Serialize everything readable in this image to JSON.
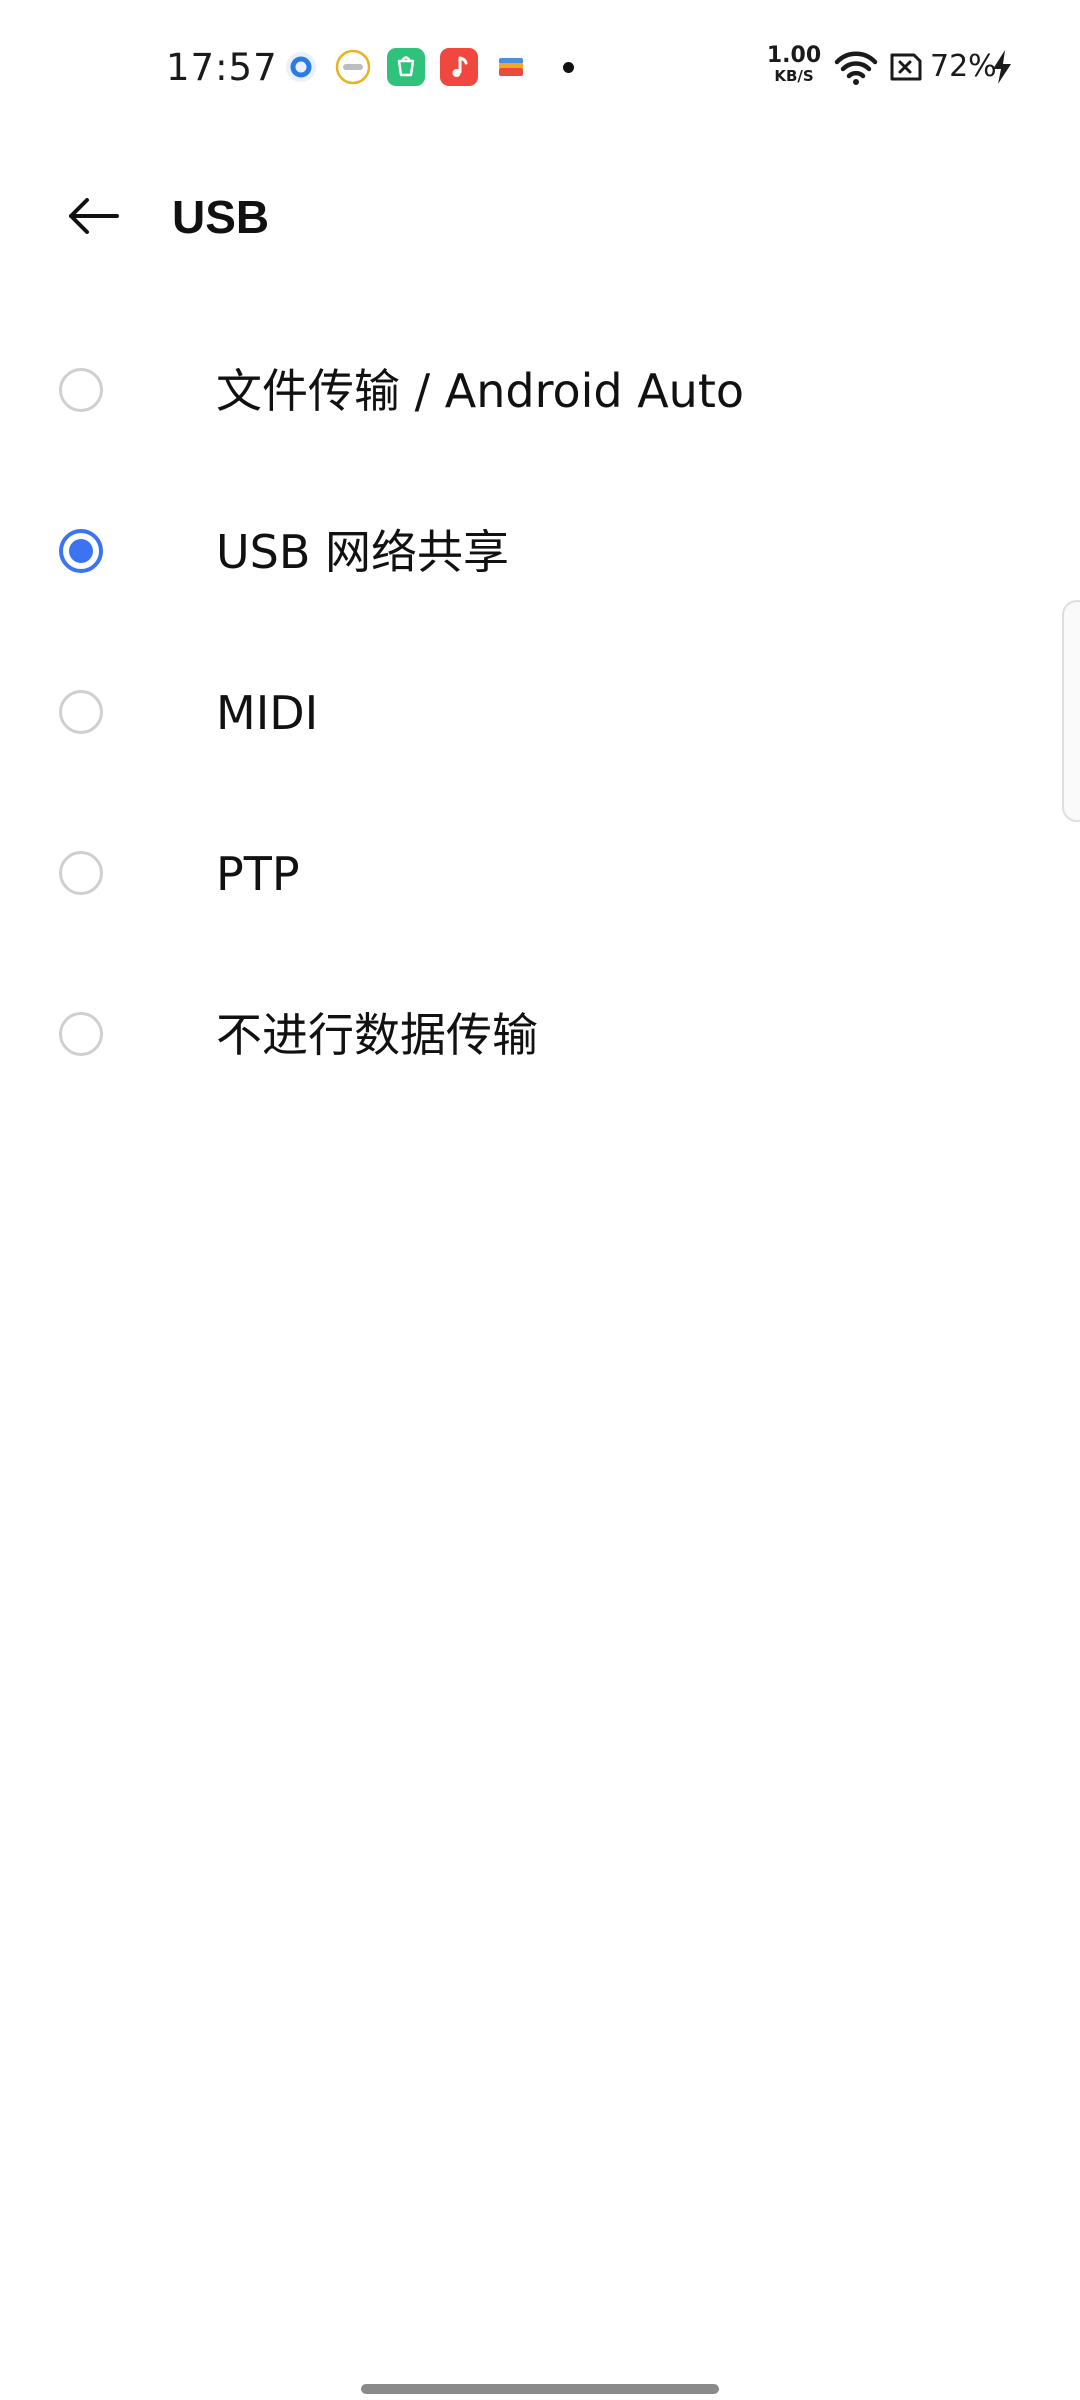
{
  "status_bar": {
    "time": "17:57",
    "notification_icons": [
      {
        "name": "notif-app-blue-circle-icon",
        "color": "#2b7be4"
      },
      {
        "name": "realme-logo-icon",
        "color": "#e8b320"
      },
      {
        "name": "store-bag-icon",
        "color": "#2fc27a"
      },
      {
        "name": "music-note-icon",
        "color": "#f0473e"
      },
      {
        "name": "wallet-card-icon",
        "color": "#f5a623"
      }
    ],
    "network_speed": {
      "value": "1.00",
      "unit": "KB/S"
    },
    "wifi_icon": "wifi-icon",
    "sim_icon": "no-sim-icon",
    "battery_percent": "72%",
    "charging_icon": "charging-bolt-icon"
  },
  "header": {
    "back_icon": "back-arrow-icon",
    "title": "USB"
  },
  "options": [
    {
      "label": "文件传输 / Android Auto",
      "selected": false
    },
    {
      "label": "USB 网络共享",
      "selected": true
    },
    {
      "label": "MIDI",
      "selected": false
    },
    {
      "label": "PTP",
      "selected": false
    },
    {
      "label": "不进行数据传输",
      "selected": false
    }
  ],
  "colors": {
    "accent": "#3b73f0",
    "radio_border": "#cfcfcf",
    "text": "#111111",
    "background": "#ffffff"
  }
}
